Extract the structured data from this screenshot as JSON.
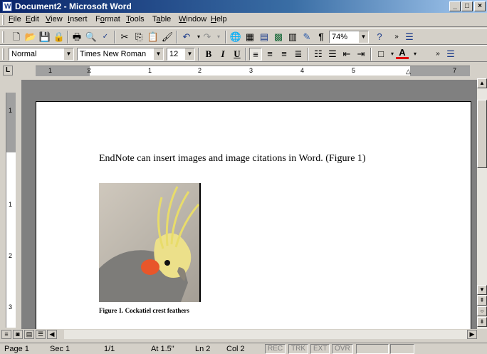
{
  "window": {
    "title": "Document2 - Microsoft Word",
    "controls": [
      "_",
      "□",
      "×"
    ]
  },
  "menubar": {
    "items": [
      {
        "pre": "",
        "u": "F",
        "post": "ile"
      },
      {
        "pre": "",
        "u": "E",
        "post": "dit"
      },
      {
        "pre": "",
        "u": "V",
        "post": "iew"
      },
      {
        "pre": "",
        "u": "I",
        "post": "nsert"
      },
      {
        "pre": "F",
        "u": "o",
        "post": "rmat"
      },
      {
        "pre": "",
        "u": "T",
        "post": "ools"
      },
      {
        "pre": "T",
        "u": "a",
        "post": "ble"
      },
      {
        "pre": "",
        "u": "W",
        "post": "indow"
      },
      {
        "pre": "",
        "u": "H",
        "post": "elp"
      }
    ]
  },
  "standard_toolbar": {
    "zoom": "74%",
    "icons": [
      "new-document-icon",
      "open-folder-icon",
      "save-icon",
      "permissions-icon",
      "print-icon",
      "print-preview-icon",
      "spelling-icon",
      "cut-icon",
      "copy-icon",
      "paste-icon",
      "format-painter-icon",
      "undo-icon",
      "redo-icon",
      "hyperlink-icon",
      "tables-borders-icon",
      "insert-table-icon",
      "insert-excel-icon",
      "columns-icon",
      "drawing-icon",
      "show-hide-icon",
      "help-icon",
      "more-buttons-icon"
    ]
  },
  "formatting_toolbar": {
    "style": "Normal",
    "font": "Times New Roman",
    "size": "12",
    "bold": "B",
    "italic": "I",
    "underline": "U"
  },
  "ruler": {
    "numbers": [
      "1",
      "1",
      "2",
      "3",
      "4",
      "5",
      "7"
    ]
  },
  "vruler": {
    "numbers": [
      "1",
      "1",
      "2",
      "3"
    ]
  },
  "document": {
    "body_text": "EndNote can insert images and image citations in Word. (Figure 1)",
    "caption": "Figure 1. Cockatiel crest feathers"
  },
  "status": {
    "page": "Page 1",
    "sec": "Sec 1",
    "pages": "1/1",
    "at": "At 1.5\"",
    "ln": "Ln 2",
    "col": "Col 2",
    "rec": "REC",
    "trk": "TRK",
    "ext": "EXT",
    "ovr": "OVR"
  }
}
